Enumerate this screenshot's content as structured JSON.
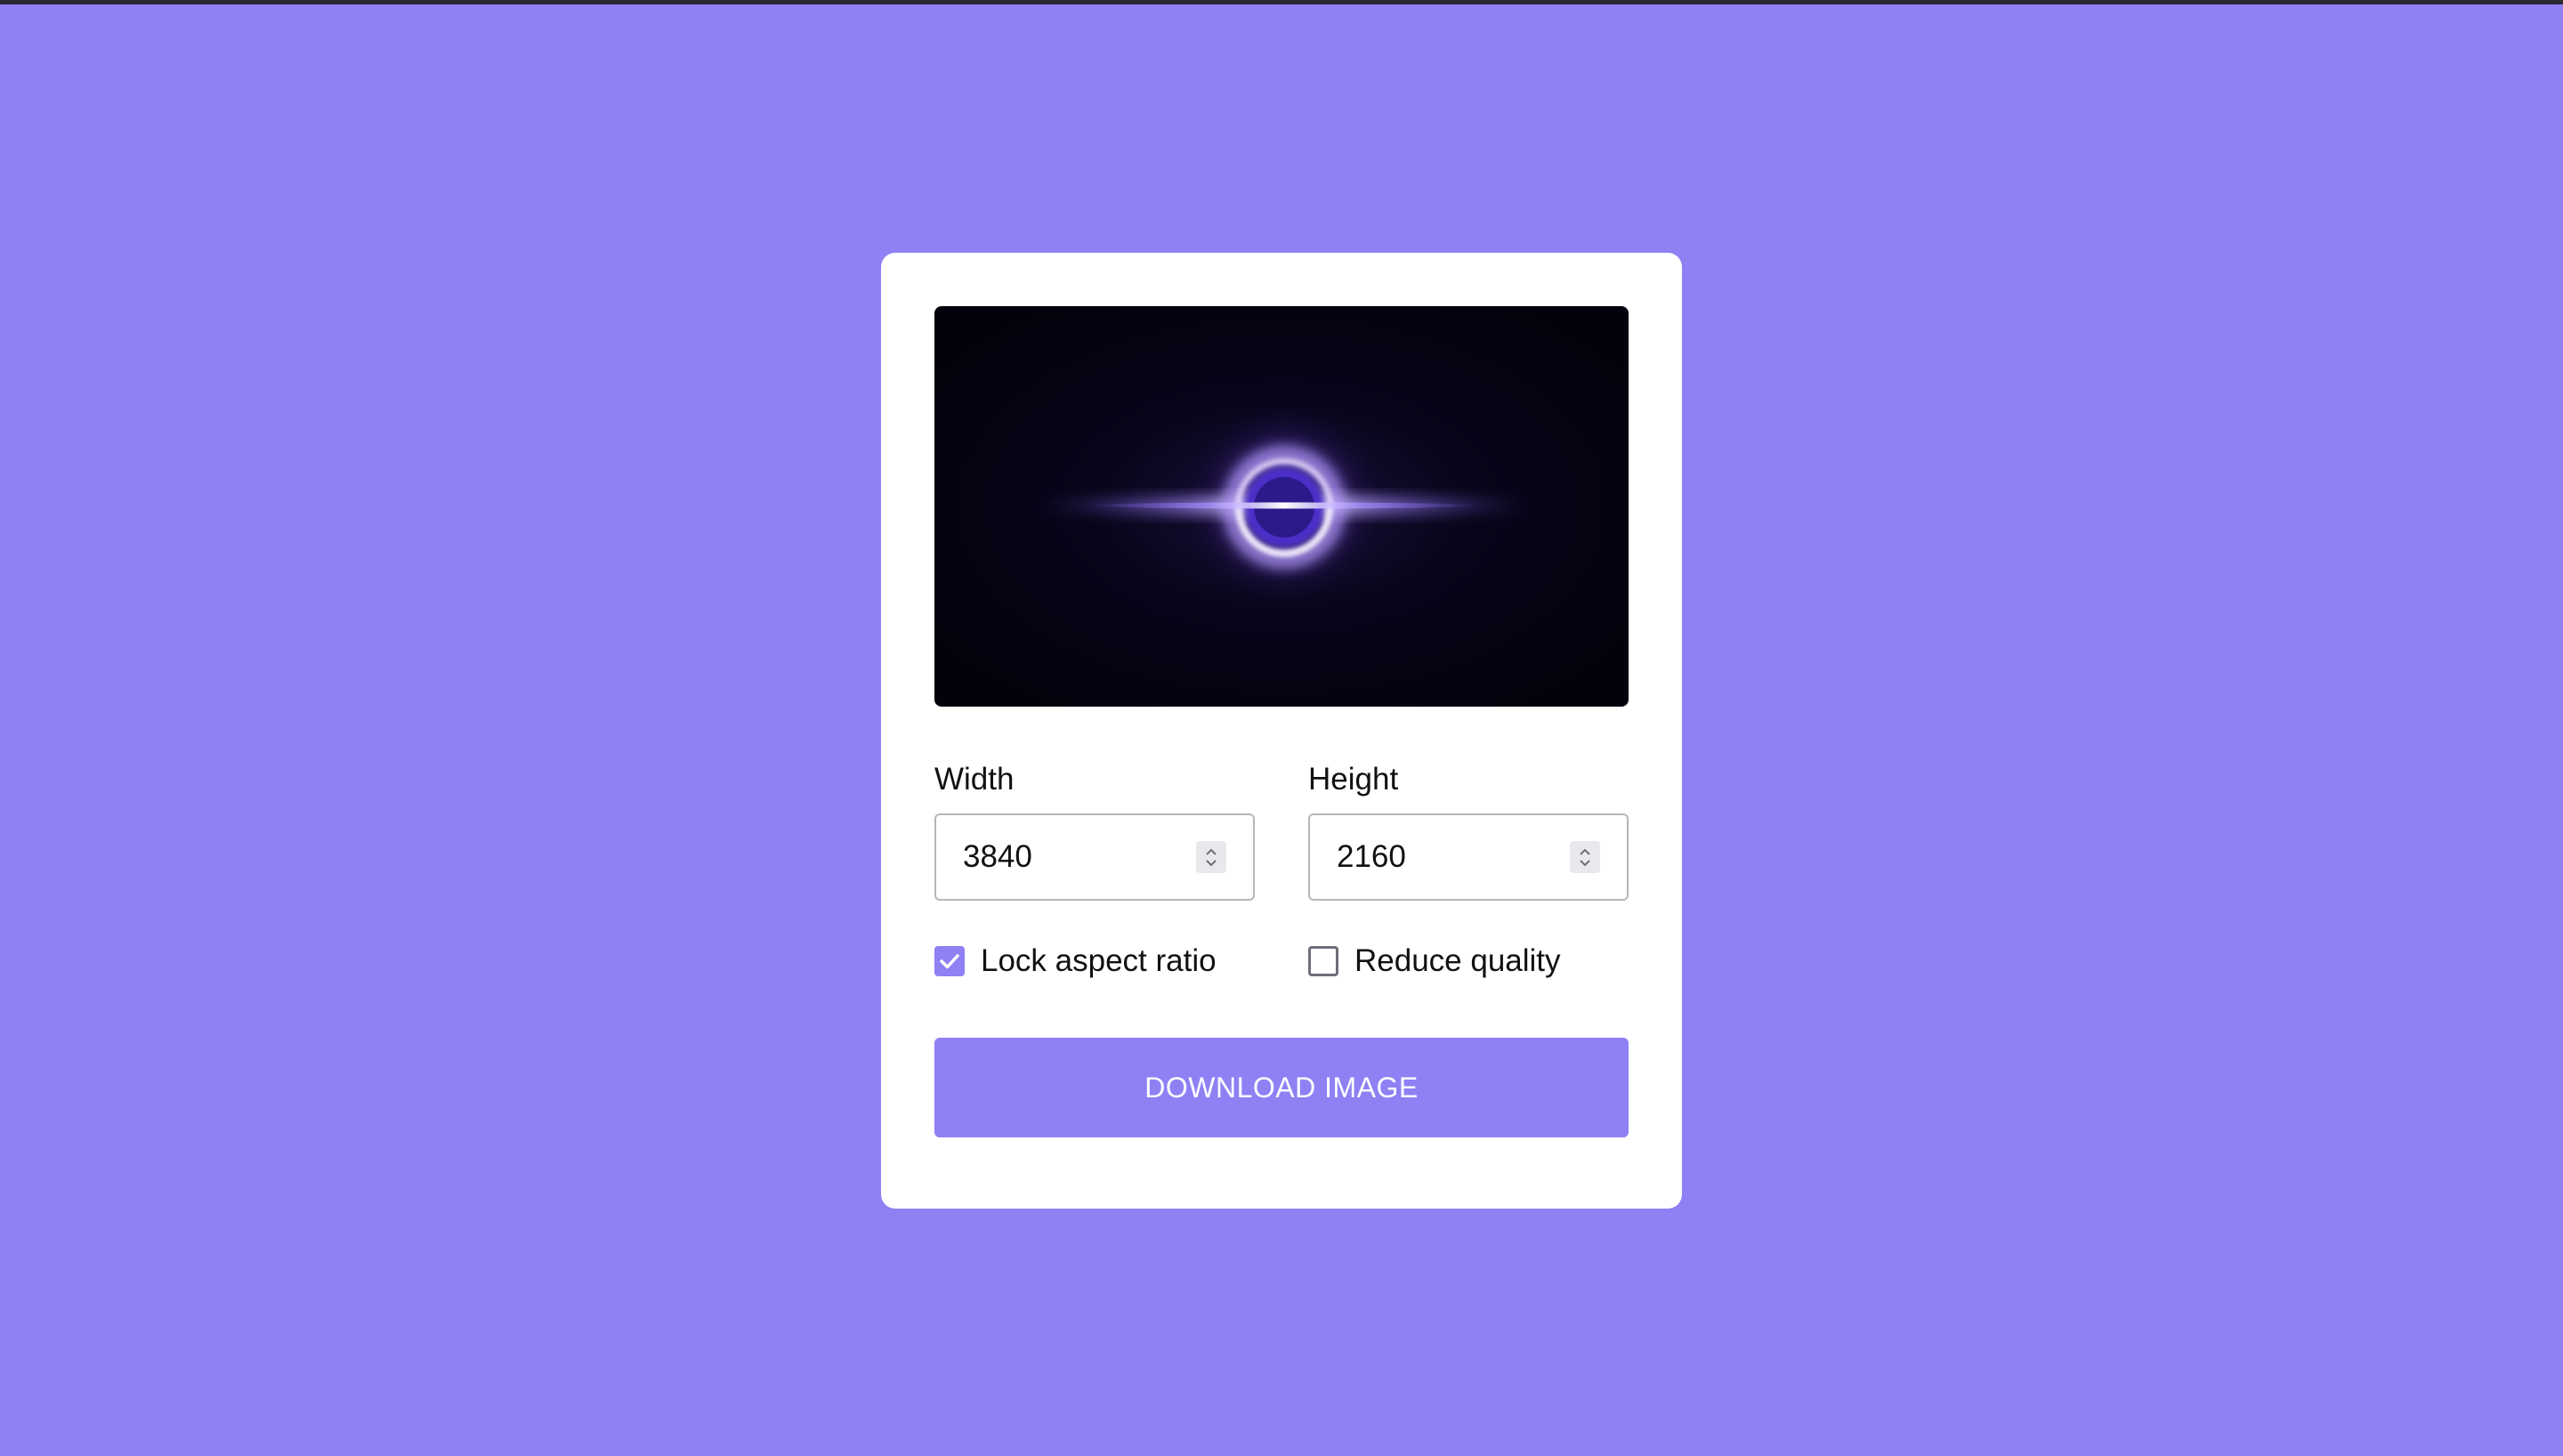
{
  "colors": {
    "background": "#8f80f4",
    "card": "#ffffff",
    "accent": "#8f80f4",
    "input_border": "#b7b7b7",
    "text": "#111111"
  },
  "preview": {
    "icon": "black-hole-image"
  },
  "width_field": {
    "label": "Width",
    "value": "3840"
  },
  "height_field": {
    "label": "Height",
    "value": "2160"
  },
  "options": {
    "lock_aspect_ratio": {
      "label": "Lock aspect ratio",
      "checked": true
    },
    "reduce_quality": {
      "label": "Reduce quality",
      "checked": false
    }
  },
  "download_button": {
    "label": "DOWNLOAD IMAGE"
  }
}
